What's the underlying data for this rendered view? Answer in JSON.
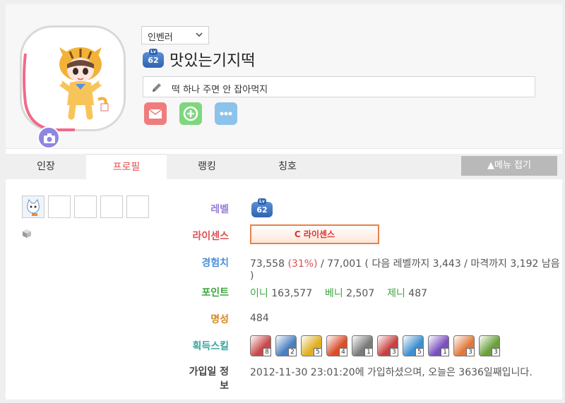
{
  "profile": {
    "server": "인벤러",
    "level_badge": "62",
    "level_badge_lv": "Lv",
    "nickname": "맛있는기지떡",
    "status_message": "떡 하나 주면 안 잡아먹지"
  },
  "tabs": [
    "인장",
    "프로필",
    "랭킹",
    "칭호"
  ],
  "active_tab": "프로필",
  "fold_button": "▲메뉴 접기",
  "info": {
    "level_label": "레벨",
    "license_label": "라이센스",
    "license_value": "C 라이센스",
    "exp_label": "경험치",
    "exp_current": "73,558",
    "exp_percent": "(31%)",
    "exp_rest": "/ 77,001 ( 다음 레벨까지 3,443 / 마격까지 3,192 남음 )",
    "point_label": "포인트",
    "ini_label": "이니",
    "ini_value": "163,577",
    "beni_label": "베니",
    "beni_value": "2,507",
    "jeni_label": "제니",
    "jeni_value": "487",
    "fame_label": "명성",
    "fame_value": "484",
    "skills_label": "획득스킬",
    "join_label": "가입일 정보",
    "join_value": "2012-11-30 23:01:20에 가입하셨으며, 오늘은 3636일째입니다."
  },
  "skills": [
    {
      "count": "8",
      "color": "#c94a4a"
    },
    {
      "count": "2",
      "color": "#4a7fc0"
    },
    {
      "count": "5",
      "color": "#e0b020"
    },
    {
      "count": "4",
      "color": "#d94f2a"
    },
    {
      "count": "1",
      "color": "#7a7a7a"
    },
    {
      "count": "3",
      "color": "#c84040"
    },
    {
      "count": "5",
      "color": "#3f8fd0"
    },
    {
      "count": "1",
      "color": "#7a4fc0"
    },
    {
      "count": "3",
      "color": "#e07a3a"
    },
    {
      "count": "3",
      "color": "#6aa03a"
    }
  ],
  "colors": {
    "level": "#9b7fd6",
    "license": "#e05050",
    "exp": "#4a90d9",
    "point": "#3ea53e",
    "fame": "#d08a2a",
    "join": "#444444",
    "skills": "#3ea5a0",
    "exp_percent": "#d9534f",
    "ini": "#3ea53e",
    "beni": "#3ea53e",
    "jeni": "#3ea53e"
  }
}
